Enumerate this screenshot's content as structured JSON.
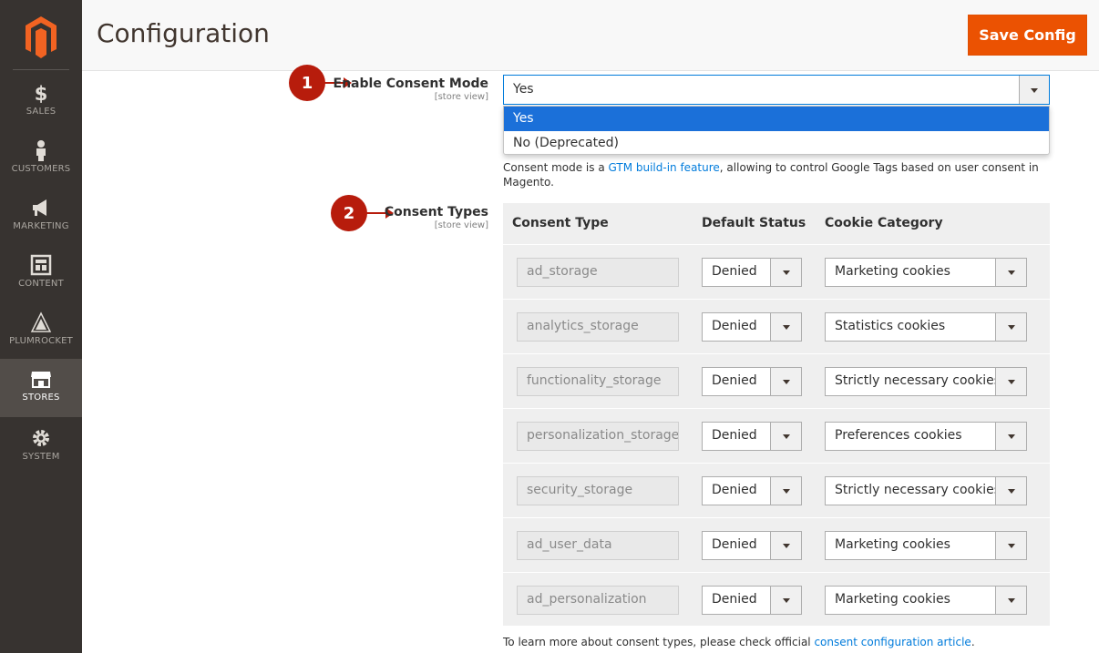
{
  "sidebar": {
    "items": [
      {
        "label": "SALES",
        "icon": "dollar-icon"
      },
      {
        "label": "CUSTOMERS",
        "icon": "person-icon"
      },
      {
        "label": "MARKETING",
        "icon": "megaphone-icon"
      },
      {
        "label": "CONTENT",
        "icon": "layout-icon"
      },
      {
        "label": "PLUMROCKET",
        "icon": "plumrocket-icon"
      },
      {
        "label": "STORES",
        "icon": "storefront-icon"
      },
      {
        "label": "SYSTEM",
        "icon": "gear-icon"
      }
    ],
    "active": "STORES"
  },
  "header": {
    "title": "Configuration",
    "save_label": "Save Config"
  },
  "markers": {
    "one": "1",
    "two": "2"
  },
  "consent_mode": {
    "label": "Enable Consent Mode",
    "scope": "[store view]",
    "value": "Yes",
    "options": [
      "Yes",
      "No (Deprecated)"
    ],
    "note_before": "Consent mode is a ",
    "note_link": "GTM build-in feature",
    "note_after": ", allowing to control Google Tags based on user consent in Magento."
  },
  "consent_types": {
    "label": "Consent Types",
    "scope": "[store view]",
    "headers": {
      "type": "Consent Type",
      "status": "Default Status",
      "category": "Cookie Category"
    },
    "rows": [
      {
        "type": "ad_storage",
        "status": "Denied",
        "category": "Marketing cookies"
      },
      {
        "type": "analytics_storage",
        "status": "Denied",
        "category": "Statistics cookies"
      },
      {
        "type": "functionality_storage",
        "status": "Denied",
        "category": "Strictly necessary cookies"
      },
      {
        "type": "personalization_storage",
        "status": "Denied",
        "category": "Preferences cookies"
      },
      {
        "type": "security_storage",
        "status": "Denied",
        "category": "Strictly necessary cookies"
      },
      {
        "type": "ad_user_data",
        "status": "Denied",
        "category": "Marketing cookies"
      },
      {
        "type": "ad_personalization",
        "status": "Denied",
        "category": "Marketing cookies"
      }
    ],
    "footer_before": "To learn more about consent types, please check official ",
    "footer_link": "consent configuration article",
    "footer_after": "."
  },
  "colors": {
    "accent": "#eb5202",
    "marker": "#b71c0c",
    "link": "#007bdb",
    "sidebar": "#373330"
  }
}
